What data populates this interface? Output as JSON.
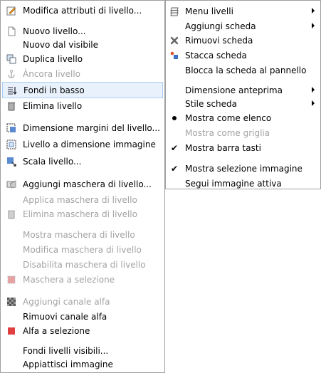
{
  "layer_menu": {
    "edit_attributes": "Modifica attributi di livello...",
    "new_layer": "Nuovo livello...",
    "new_from_visible": "Nuovo dal visibile",
    "duplicate_layer": "Duplica livello",
    "anchor_layer": "Àncora livello",
    "merge_down": "Fondi in basso",
    "delete_layer": "Elimina livello",
    "layer_boundary_size": "Dimensione margini del livello...",
    "layer_to_image_size": "Livello a dimensione immagine",
    "scale_layer": "Scala livello...",
    "add_layer_mask": "Aggiungi maschera di livello...",
    "apply_layer_mask": "Applica maschera di livello",
    "delete_layer_mask": "Elimina maschera di livello",
    "show_layer_mask": "Mostra maschera di livello",
    "edit_layer_mask": "Modifica maschera di livello",
    "disable_layer_mask": "Disabilita maschera di livello",
    "mask_to_selection": "Maschera a selezione",
    "add_alpha_channel": "Aggiungi canale alfa",
    "remove_alpha_channel": "Rimuovi canale alfa",
    "alpha_to_selection": "Alfa a selezione",
    "merge_visible_layers": "Fondi livelli visibili...",
    "flatten_image": "Appiattisci immagine"
  },
  "tab_menu": {
    "layers_menu": "Menu livelli",
    "add_tab": "Aggiungi scheda",
    "remove_tab": "Rimuovi scheda",
    "detach_tab": "Stacca scheda",
    "lock_tab_to_dock": "Blocca la scheda al pannello",
    "preview_size": "Dimensione anteprima",
    "tab_style": "Stile scheda",
    "view_as_list": "Mostra come elenco",
    "view_as_grid": "Mostra come griglia",
    "show_button_bar": "Mostra barra tasti",
    "show_image_selection": "Mostra selezione immagine",
    "auto_follow_active_image": "Segui immagine attiva"
  },
  "colors": {
    "hover_bg": "#e9f2fc",
    "hover_border": "#a8cdf2",
    "disabled_text": "#a3a3a3",
    "mask_red": "#e04040"
  }
}
